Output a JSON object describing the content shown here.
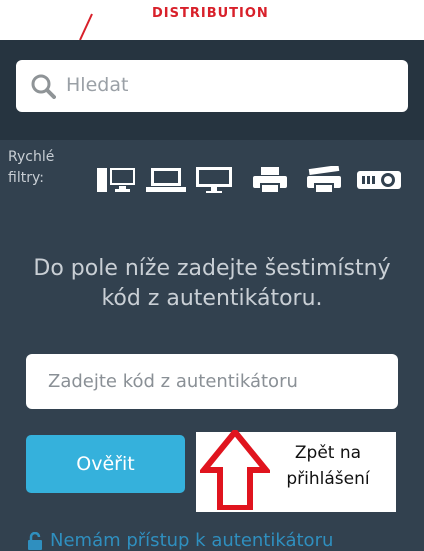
{
  "header": {
    "brand_text": "DISTRIBUTION"
  },
  "search": {
    "placeholder": "Hledat"
  },
  "quick_filters": {
    "label": "Rychlé filtry:",
    "icons": [
      "desktop-pc-icon",
      "laptop-icon",
      "monitor-icon",
      "printer-icon",
      "multifunction-printer-icon",
      "projector-icon"
    ]
  },
  "auth": {
    "message": "Do pole níže zadejte šestimístný kód z autentikátoru.",
    "code_placeholder": "Zadejte kód z autentikátoru",
    "verify_label": "Ověřit",
    "no_access_label": "Nemám přístup k autentikátoru"
  },
  "annotation": {
    "text": "Zpět na přihlášení",
    "arrow_color": "#e0141e"
  },
  "colors": {
    "accent": "#35b1dc",
    "brand": "#d8202a",
    "background": "#32414f"
  }
}
